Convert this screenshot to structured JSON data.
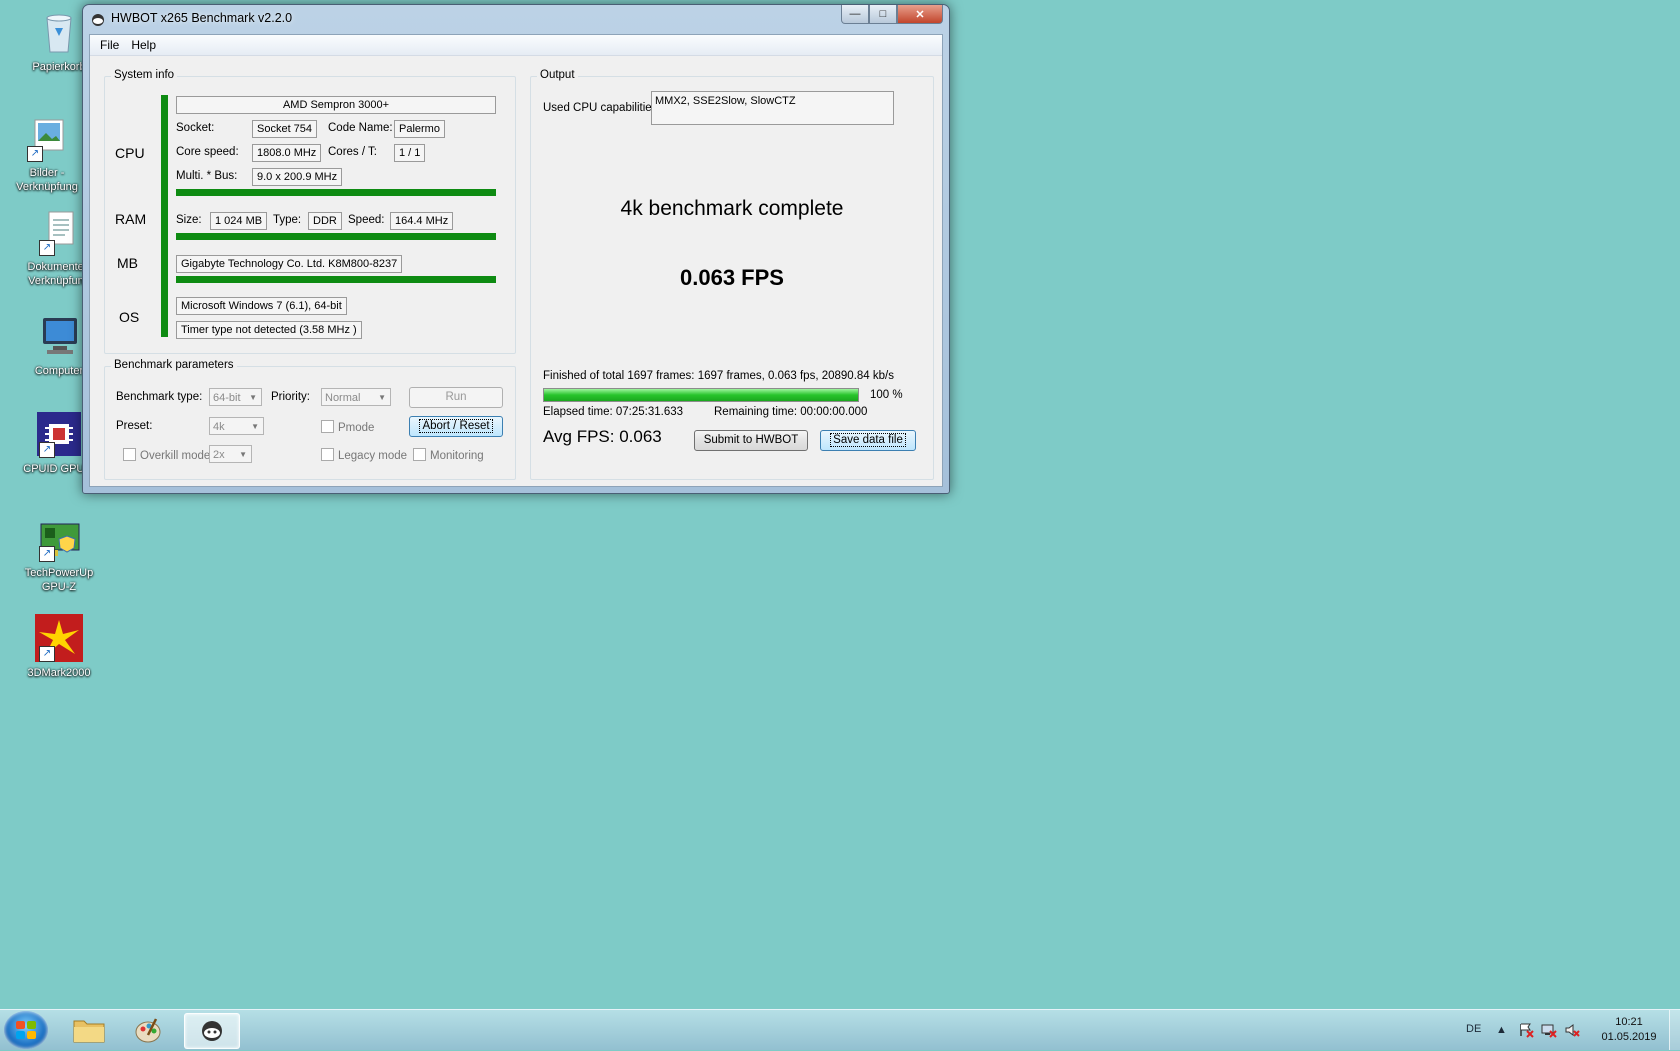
{
  "desktop": {
    "icons": [
      {
        "label": "Papierkorb"
      },
      {
        "label": "Bilder - Verknüpfung"
      },
      {
        "label": "Dokumente - Verknüpfung"
      },
      {
        "label": "Computer"
      },
      {
        "label": "CPUID GPU-Z"
      },
      {
        "label": "TechPowerUp GPU-Z"
      },
      {
        "label": "3DMark2000"
      }
    ]
  },
  "window": {
    "title": "HWBOT x265 Benchmark v2.2.0",
    "menu": {
      "file": "File",
      "help": "Help"
    }
  },
  "system_info": {
    "group_label": "System info",
    "cpu_label": "CPU",
    "cpu_name": "AMD Sempron 3000+",
    "socket_label": "Socket:",
    "socket": "Socket 754",
    "codename_label": "Code Name:",
    "codename": "Palermo",
    "corespeed_label": "Core speed:",
    "corespeed": "1808.0 MHz",
    "cores_label": "Cores / T:",
    "cores": "1 / 1",
    "multi_label": "Multi. * Bus:",
    "multi": "9.0 x 200.9 MHz",
    "ram_label": "RAM",
    "size_label": "Size:",
    "size": "1 024 MB",
    "type_label": "Type:",
    "type": "DDR",
    "speed_label": "Speed:",
    "speed": "164.4 MHz",
    "mb_label": "MB",
    "mb": "Gigabyte Technology Co. Ltd. K8M800-8237",
    "os_label": "OS",
    "os": "Microsoft Windows 7 (6.1), 64-bit",
    "timer": "Timer type not detected (3.58 MHz )"
  },
  "benchmark_params": {
    "group_label": "Benchmark parameters",
    "type_label": "Benchmark type:",
    "type_value": "64-bit",
    "priority_label": "Priority:",
    "priority_value": "Normal",
    "run_label": "Run",
    "preset_label": "Preset:",
    "preset_value": "4k",
    "pmode_label": "Pmode",
    "abort_label": "Abort / Reset",
    "overkill_label": "Overkill mode",
    "overkill_value": "2x",
    "legacy_label": "Legacy mode",
    "monitoring_label": "Monitoring"
  },
  "output": {
    "group_label": "Output",
    "cpu_caps_label": "Used CPU capabilities:",
    "cpu_caps": "MMX2, SSE2Slow, SlowCTZ",
    "status": "4k benchmark complete",
    "fps": "0.063 FPS",
    "finished": "Finished of total 1697 frames: 1697 frames, 0.063 fps,  20890.84 kb/s",
    "progress_percent": 100,
    "progress_label": "100 %",
    "elapsed": "Elapsed time: 07:25:31.633",
    "remaining": "Remaining time: 00:00:00.000",
    "avg_fps": "Avg FPS: 0.063",
    "submit_label": "Submit to HWBOT",
    "save_label": "Save data file"
  },
  "taskbar": {
    "language": "DE",
    "time": "10:21",
    "date": "01.05.2019"
  },
  "colors": {
    "desktop": "#7ecbc7",
    "green_bar": "#0e8b12",
    "progress_fill": "#27c42b"
  }
}
